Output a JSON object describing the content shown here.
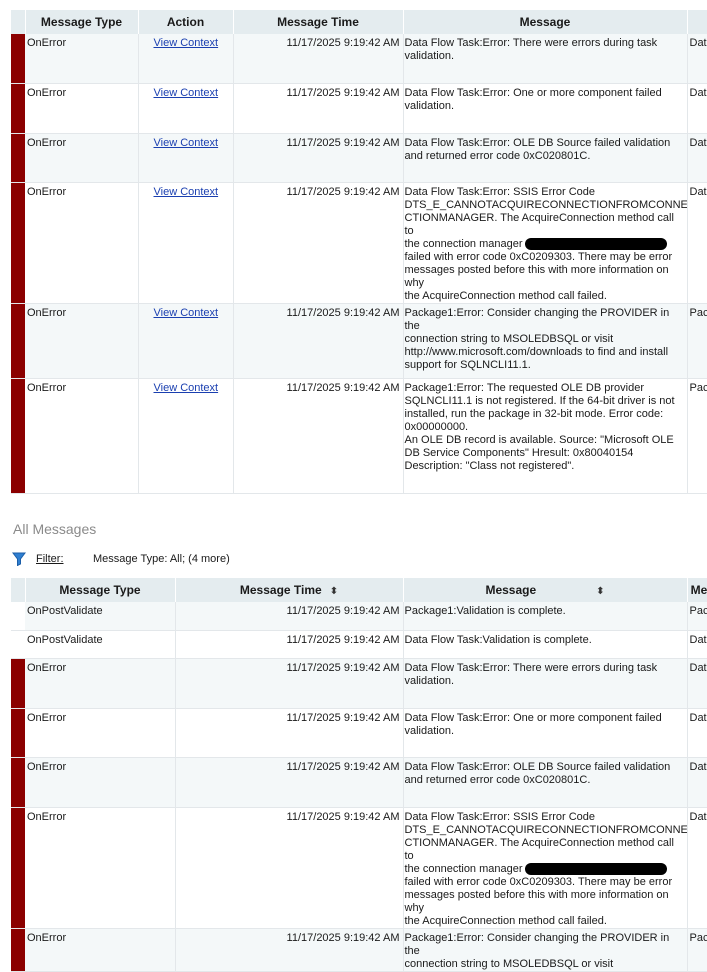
{
  "context_grid": {
    "columns": [
      "Message Type",
      "Action",
      "Message Time",
      "Message",
      ""
    ],
    "rows": [
      {
        "type": "OnError",
        "action": "View Context",
        "time": "11/17/2025 9:19:42 AM",
        "source": "Data",
        "lines": [
          "Data Flow Task:Error: There were errors during task",
          "validation."
        ]
      },
      {
        "type": "OnError",
        "action": "View Context",
        "time": "11/17/2025 9:19:42 AM",
        "source": "Data",
        "lines": [
          "Data Flow Task:Error: One or more component failed",
          "validation."
        ]
      },
      {
        "type": "OnError",
        "action": "View Context",
        "time": "11/17/2025 9:19:42 AM",
        "source": "Data",
        "lines": [
          "Data Flow Task:Error: OLE DB Source failed validation",
          "and returned error code 0xC020801C."
        ]
      },
      {
        "type": "OnError",
        "action": "View Context",
        "time": "11/17/2025 9:19:42 AM",
        "source": "Data",
        "lines": [
          "Data Flow Task:Error: SSIS Error Code",
          "DTS_E_CANNOTACQUIRECONNECTIONFROMCONNE",
          "CTIONMANAGER.  The AcquireConnection method call to",
          "the connection manager",
          "failed with error code 0xC0209303.  There may be error",
          "messages posted before this with more information on why",
          "the AcquireConnection method call failed."
        ]
      },
      {
        "type": "OnError",
        "action": "View Context",
        "time": "11/17/2025 9:19:42 AM",
        "source": "Pac",
        "lines": [
          "Package1:Error: Consider changing the PROVIDER in the",
          "connection string to MSOLEDBSQL or visit",
          "http://www.microsoft.com/downloads to find and install",
          "support for SQLNCLI11.1."
        ]
      },
      {
        "type": "OnError",
        "action": "View Context",
        "time": "11/17/2025 9:19:42 AM",
        "source": "Pac",
        "lines": [
          "Package1:Error: The requested OLE DB provider",
          "SQLNCLI11.1 is not registered. If the 64-bit driver is not",
          "installed, run the package in 32-bit mode. Error code:",
          "0x00000000.",
          "An OLE DB record is available.  Source: \"Microsoft OLE",
          "DB Service Components\"  Hresult: 0x80040154",
          "Description: \"Class not registered\"."
        ]
      }
    ]
  },
  "all_messages": {
    "title": "All Messages",
    "filter_label": "Filter:",
    "filter_value": "Message Type: All;  (4 more)",
    "columns": [
      "Message Type",
      "Message Time",
      "Message",
      "Me"
    ],
    "sort_glyph": "⬍",
    "rows": [
      {
        "type": "OnPostValidate",
        "time": "11/17/2025 9:19:42 AM",
        "source": "Pac",
        "error": false,
        "lines": [
          "Package1:Validation is complete."
        ]
      },
      {
        "type": "OnPostValidate",
        "time": "11/17/2025 9:19:42 AM",
        "source": "Data",
        "error": false,
        "lines": [
          "Data Flow Task:Validation is complete."
        ]
      },
      {
        "type": "OnError",
        "time": "11/17/2025 9:19:42 AM",
        "source": "Data",
        "error": true,
        "lines": [
          "Data Flow Task:Error: There were errors during task",
          "validation."
        ]
      },
      {
        "type": "OnError",
        "time": "11/17/2025 9:19:42 AM",
        "source": "Data",
        "error": true,
        "lines": [
          "Data Flow Task:Error: One or more component failed",
          "validation."
        ]
      },
      {
        "type": "OnError",
        "time": "11/17/2025 9:19:42 AM",
        "source": "Data",
        "error": true,
        "lines": [
          "Data Flow Task:Error: OLE DB Source failed validation",
          "and returned error code 0xC020801C."
        ]
      },
      {
        "type": "OnError",
        "time": "11/17/2025 9:19:42 AM",
        "source": "Data",
        "error": true,
        "lines": [
          "Data Flow Task:Error: SSIS Error Code",
          "DTS_E_CANNOTACQUIRECONNECTIONFROMCONNE",
          "CTIONMANAGER.  The AcquireConnection method call to",
          "the connection manager",
          "failed with error code 0xC0209303.  There may be error",
          "messages posted before this with more information on why",
          "the AcquireConnection method call failed."
        ]
      },
      {
        "type": "OnError",
        "time": "11/17/2025 9:19:42 AM",
        "source": "Pac",
        "error": true,
        "lines": [
          "Package1:Error: Consider changing the PROVIDER in the",
          "connection string to MSOLEDBSQL or visit"
        ]
      }
    ]
  },
  "colors": {
    "error_marker": "#8b0000",
    "header_bg": "#e4ecef",
    "link": "#1a3fb0"
  },
  "icons": {
    "filter": "filter-funnel-icon",
    "sort": "sort-updown-icon"
  }
}
